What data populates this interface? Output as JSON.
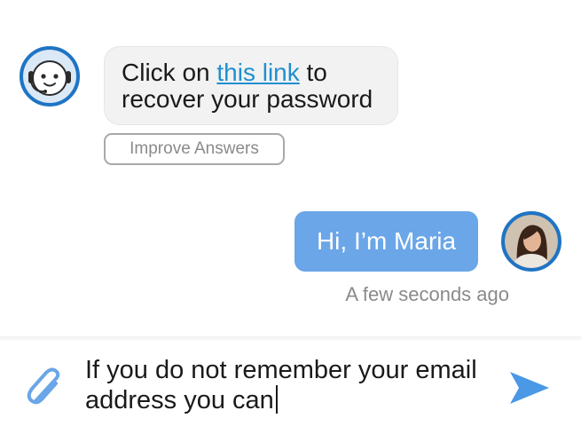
{
  "bot_message": {
    "prefix": "Click on ",
    "link_text": "this link",
    "suffix_line1": " to",
    "line2": "recover your password"
  },
  "improve_button_label": "Improve Answers",
  "user_message": "Hi, I’m Maria",
  "timestamp": "A few seconds ago",
  "composer": {
    "line1": "If you do not remember your email",
    "line2": "address you can"
  },
  "icons": {
    "bot_avatar": "robot-avatar-icon",
    "user_avatar": "user-avatar-photo",
    "attach": "paperclip-icon",
    "send": "send-arrow-icon"
  },
  "colors": {
    "accent": "#1f74c4",
    "user_bubble": "#6aa6e8",
    "link": "#1f8fd0",
    "bot_bubble": "#f2f2f2"
  }
}
